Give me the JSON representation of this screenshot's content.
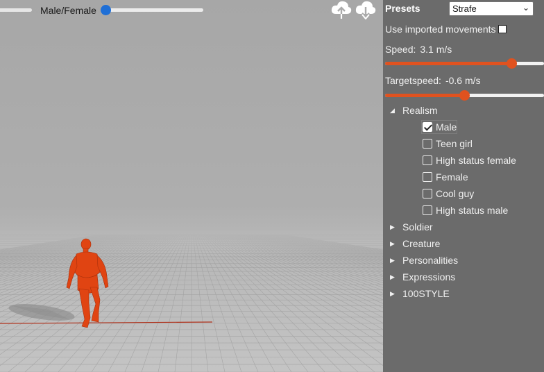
{
  "viewport": {
    "gender_slider": {
      "label": "Male/Female",
      "value": 0.0
    }
  },
  "cloud": {
    "upload_icon": "cloud-upload-icon",
    "download_icon": "cloud-download-icon"
  },
  "panel": {
    "presets": {
      "label": "Presets",
      "selected": "Strafe"
    },
    "use_imported": {
      "label": "Use imported movements",
      "checked": false
    },
    "speed": {
      "label": "Speed:",
      "value": "3.1 m/s",
      "fraction": 0.82
    },
    "targetspeed": {
      "label": "Targetspeed:",
      "value": "-0.6 m/s",
      "fraction": 0.5
    },
    "tree": {
      "realism": {
        "label": "Realism",
        "expanded": true,
        "items": [
          {
            "label": "Male",
            "checked": true
          },
          {
            "label": "Teen girl",
            "checked": false
          },
          {
            "label": "High status female",
            "checked": false
          },
          {
            "label": "Female",
            "checked": false
          },
          {
            "label": "Cool guy",
            "checked": false
          },
          {
            "label": "High status male",
            "checked": false
          }
        ]
      },
      "categories": [
        {
          "label": "Soldier"
        },
        {
          "label": "Creature"
        },
        {
          "label": "Personalities"
        },
        {
          "label": "Expressions"
        },
        {
          "label": "100STYLE"
        }
      ]
    }
  },
  "colors": {
    "accent": "#e0521f",
    "slider_blue": "#1f6fd6",
    "panel_bg": "#6b6b6b"
  }
}
